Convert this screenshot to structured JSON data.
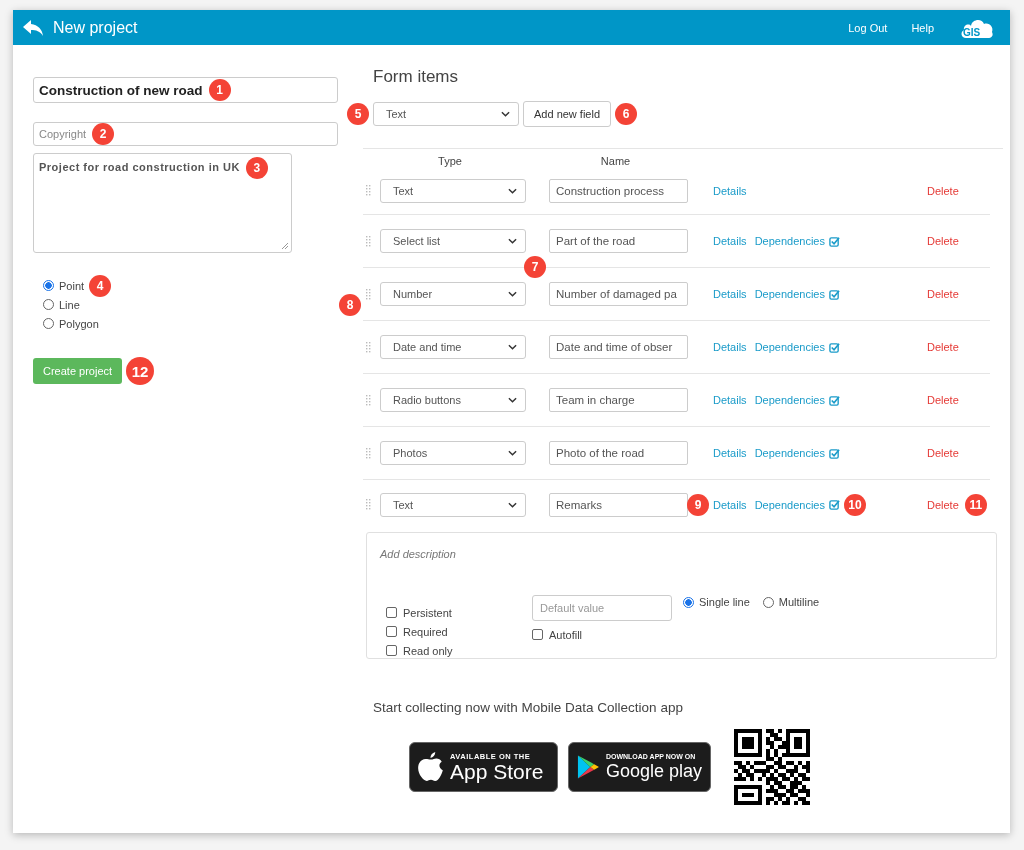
{
  "header": {
    "title": "New project",
    "links": [
      "Log Out",
      "Help"
    ],
    "logo": "GIS"
  },
  "project": {
    "name": "Construction of new road",
    "name_callout": "1",
    "copyright_placeholder": "Copyright",
    "copyright_callout": "2",
    "description": "Project for road construction in UK",
    "description_callout": "3"
  },
  "geometry": [
    {
      "label": "Point",
      "selected": true,
      "callout": "4"
    },
    {
      "label": "Line",
      "selected": false
    },
    {
      "label": "Polygon",
      "selected": false
    }
  ],
  "create_button": {
    "label": "Create project",
    "callout": "12"
  },
  "form_items": {
    "title": "Form items",
    "new_type": "Text",
    "new_type_callout": "5",
    "add_button": "Add new field",
    "add_callout": "6",
    "columns": [
      "Type",
      "Name"
    ],
    "rows": [
      {
        "type": "Text",
        "name": "Construction process",
        "details": "Details",
        "delete": "Delete"
      },
      {
        "type": "Select list",
        "name": "Part of the road",
        "details": "Details",
        "dependencies": "Dependencies",
        "delete": "Delete"
      },
      {
        "type": "Number",
        "name": "Number of damaged pa",
        "details": "Details",
        "dependencies": "Dependencies",
        "delete": "Delete",
        "top_callout": "7",
        "handle_callout": "8"
      },
      {
        "type": "Date and time",
        "name": "Date and time of obser",
        "details": "Details",
        "dependencies": "Dependencies",
        "delete": "Delete"
      },
      {
        "type": "Radio buttons",
        "name": "Team in charge",
        "details": "Details",
        "dependencies": "Dependencies",
        "delete": "Delete"
      },
      {
        "type": "Photos",
        "name": "Photo of the road",
        "details": "Details",
        "dependencies": "Dependencies",
        "delete": "Delete"
      },
      {
        "type": "Text",
        "name": "Remarks",
        "details": "Details",
        "dependencies": "Dependencies",
        "delete": "Delete",
        "details_callout": "9",
        "dependencies_callout": "10",
        "delete_callout": "11"
      }
    ],
    "details_panel": {
      "description_placeholder": "Add description",
      "checkboxes": [
        {
          "label": "Persistent",
          "checked": false
        },
        {
          "label": "Required",
          "checked": false
        },
        {
          "label": "Read only",
          "checked": false
        }
      ],
      "default_placeholder": "Default value",
      "autofill": {
        "label": "Autofill",
        "checked": false
      },
      "line_modes": [
        {
          "label": "Single line",
          "selected": true
        },
        {
          "label": "Multiline",
          "selected": false
        }
      ]
    }
  },
  "footer": {
    "text": "Start collecting now with Mobile Data Collection app",
    "app_store": {
      "small": "AVAILABLE ON THE",
      "big": "App Store"
    },
    "google_play": {
      "small": "DOWNLOAD APP NOW ON",
      "big": "Google play"
    }
  }
}
